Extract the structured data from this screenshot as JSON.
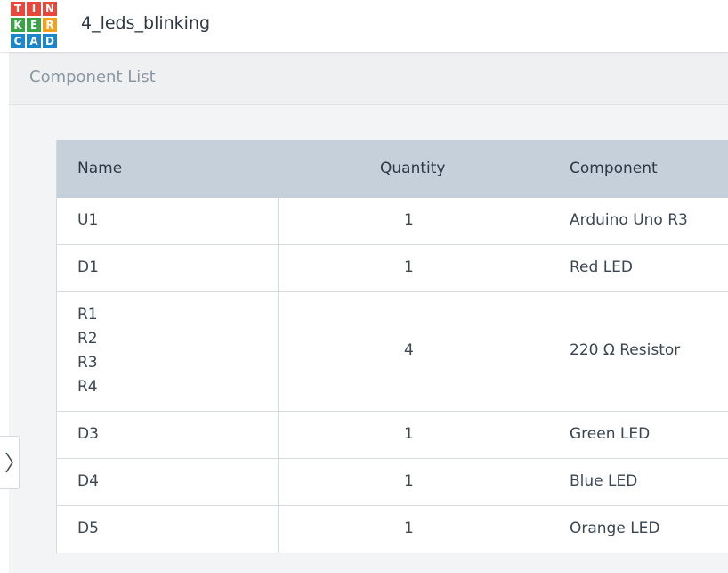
{
  "app": {
    "project_title": "4_leds_blinking",
    "logo": {
      "letters": [
        "T",
        "I",
        "N",
        "K",
        "E",
        "R",
        "C",
        "A",
        "D"
      ],
      "colors": [
        "#e8473c",
        "#e8473c",
        "#e8473c",
        "#3aa346",
        "#3aa346",
        "#f0a21f",
        "#1b86c9",
        "#1b86c9",
        "#1b86c9"
      ]
    }
  },
  "component_list": {
    "title": "Component List",
    "columns": {
      "name": "Name",
      "quantity": "Quantity",
      "component": "Component"
    },
    "rows": [
      {
        "names": [
          "U1"
        ],
        "quantity": "1",
        "component": "Arduino Uno R3"
      },
      {
        "names": [
          "D1"
        ],
        "quantity": "1",
        "component": "Red LED"
      },
      {
        "names": [
          "R1",
          "R2",
          "R3",
          "R4"
        ],
        "quantity": "4",
        "component": "220 Ω Resistor"
      },
      {
        "names": [
          "D3"
        ],
        "quantity": "1",
        "component": "Green LED"
      },
      {
        "names": [
          "D4"
        ],
        "quantity": "1",
        "component": "Blue LED"
      },
      {
        "names": [
          "D5"
        ],
        "quantity": "1",
        "component": "Orange LED"
      }
    ]
  },
  "sidebar_toggle": {
    "icon": "chevron-right-icon"
  }
}
